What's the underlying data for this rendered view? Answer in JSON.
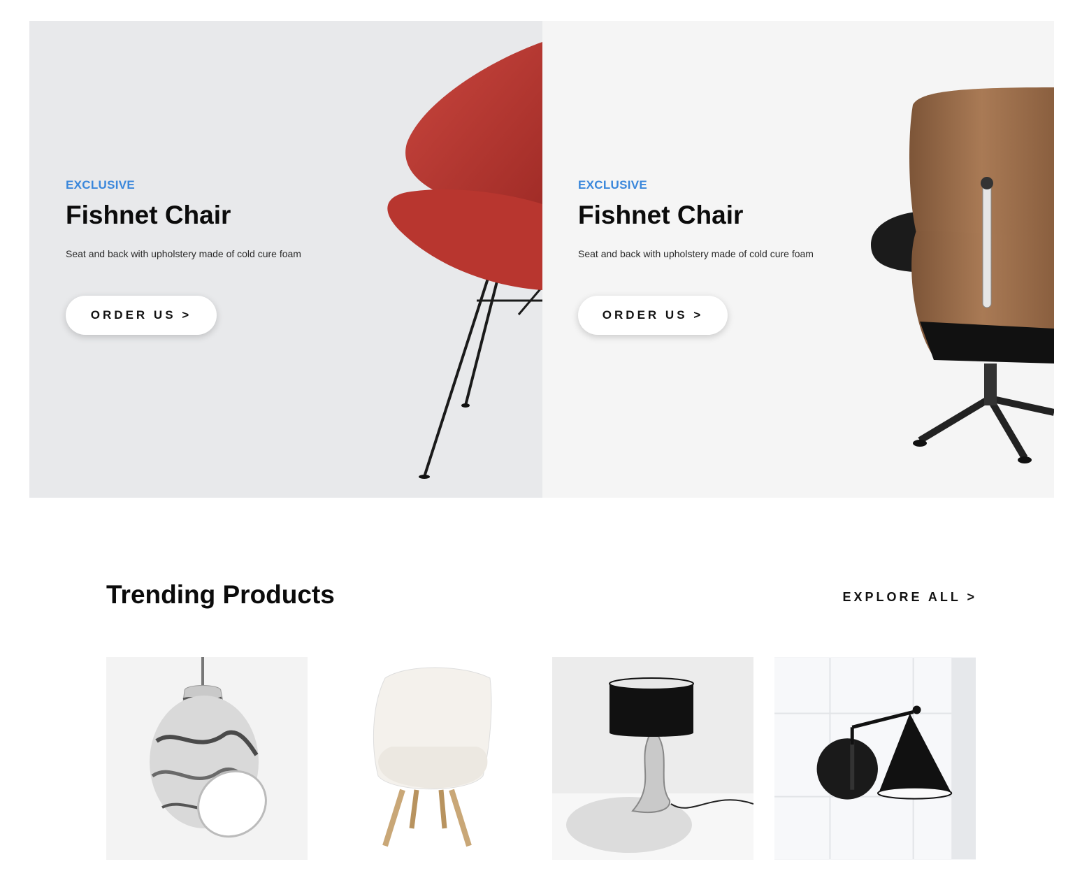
{
  "banners": [
    {
      "eyebrow": "EXCLUSIVE",
      "title": "Fishnet Chair",
      "description": "Seat and back with upholstery made of cold cure foam",
      "button_label": "ORDER US >",
      "image": "red-shell-chair-icon"
    },
    {
      "eyebrow": "EXCLUSIVE",
      "title": "Fishnet Chair",
      "description": "Seat and back with upholstery made of cold cure foam",
      "button_label": "ORDER US >",
      "image": "lounge-chair-icon"
    }
  ],
  "trending": {
    "title": "Trending Products",
    "explore_label": "EXPLORE ALL >",
    "products": [
      {
        "image": "marble-pendant-lamp-icon"
      },
      {
        "image": "white-shell-chair-icon"
      },
      {
        "image": "black-table-lamp-icon"
      },
      {
        "image": "black-wall-lamp-icon"
      }
    ]
  },
  "colors": {
    "accent": "#3a87db",
    "text": "#0b0b0b",
    "banner_left_bg": "#e8e9eb",
    "banner_right_bg": "#f5f5f5"
  }
}
